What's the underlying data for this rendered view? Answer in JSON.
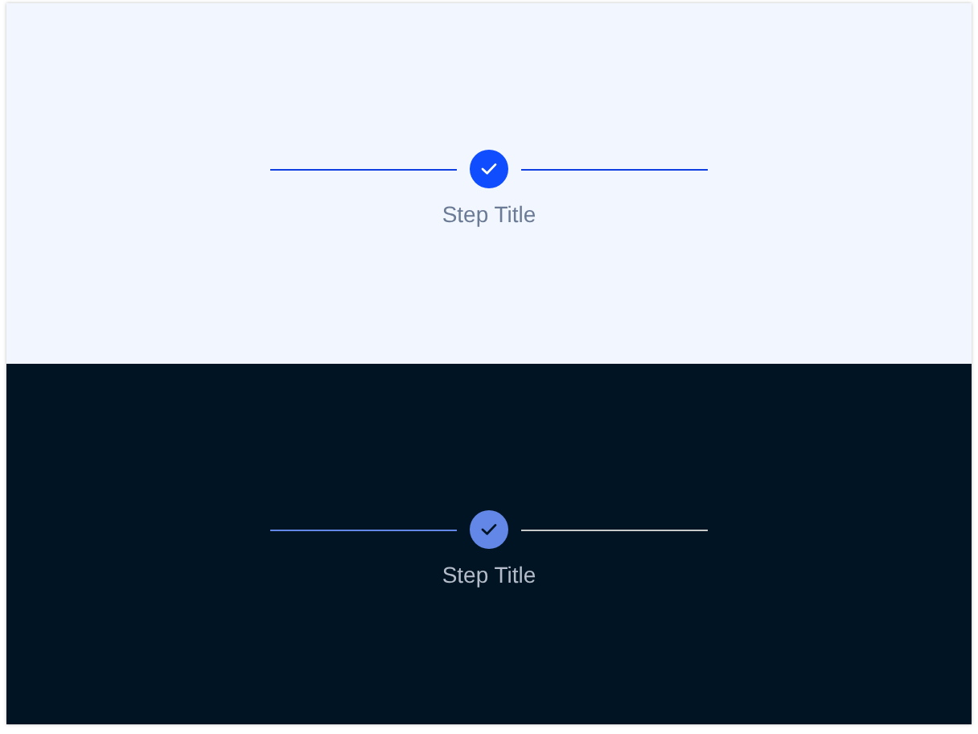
{
  "panels": [
    {
      "kind": "light",
      "step": {
        "title": "Step Title",
        "completed": true
      },
      "connectors": [
        {
          "active": true
        },
        {
          "active": true
        }
      ]
    },
    {
      "kind": "dark",
      "step": {
        "title": "Step Title",
        "completed": true
      },
      "connectors": [
        {
          "active": true
        },
        {
          "active": false
        }
      ]
    }
  ]
}
